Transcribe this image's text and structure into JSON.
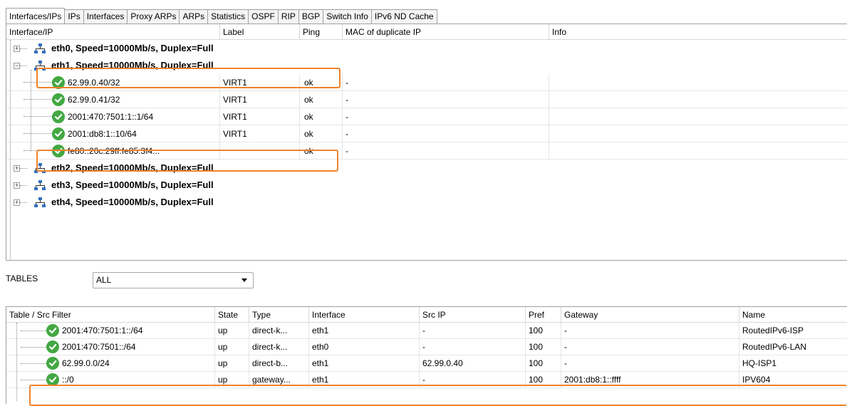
{
  "tabs": [
    {
      "label": "Interfaces/IPs",
      "active": true
    },
    {
      "label": "IPs",
      "active": false
    },
    {
      "label": "Interfaces",
      "active": false
    },
    {
      "label": "Proxy ARPs",
      "active": false
    },
    {
      "label": "ARPs",
      "active": false
    },
    {
      "label": "Statistics",
      "active": false
    },
    {
      "label": "OSPF",
      "active": false
    },
    {
      "label": "RIP",
      "active": false
    },
    {
      "label": "BGP",
      "active": false
    },
    {
      "label": "Switch Info",
      "active": false
    },
    {
      "label": "IPv6 ND Cache",
      "active": false
    }
  ],
  "tree": {
    "columns": [
      "Interface/IP",
      "Label",
      "Ping",
      "MAC of duplicate IP",
      "Info"
    ],
    "interfaces": [
      {
        "label": "eth0, Speed=10000Mb/s, Duplex=Full",
        "expanded": false,
        "ips": []
      },
      {
        "label": "eth1, Speed=10000Mb/s, Duplex=Full",
        "expanded": true,
        "ips": [
          {
            "ip": "62.99.0.40/32",
            "label": "VIRT1",
            "ping": "ok",
            "mac": "-",
            "info": ""
          },
          {
            "ip": "62.99.0.41/32",
            "label": "VIRT1",
            "ping": "ok",
            "mac": "-",
            "info": ""
          },
          {
            "ip": "2001:470:7501:1::1/64",
            "label": "VIRT1",
            "ping": "ok",
            "mac": "-",
            "info": ""
          },
          {
            "ip": "2001:db8:1::10/64",
            "label": "VIRT1",
            "ping": "ok",
            "mac": "-",
            "info": ""
          },
          {
            "ip": "fe80::20c:29ff:fe85:3f4...",
            "label": "",
            "ping": "ok",
            "mac": "-",
            "info": ""
          }
        ]
      },
      {
        "label": "eth2, Speed=10000Mb/s, Duplex=Full",
        "expanded": false,
        "ips": []
      },
      {
        "label": "eth3, Speed=10000Mb/s, Duplex=Full",
        "expanded": false,
        "ips": []
      },
      {
        "label": "eth4, Speed=10000Mb/s, Duplex=Full",
        "expanded": false,
        "ips": []
      }
    ]
  },
  "tables_selector": {
    "label": "TABLES",
    "value": "ALL"
  },
  "routes": {
    "columns": [
      "Table / Src Filter",
      "State",
      "Type",
      "Interface",
      "Src IP",
      "Pref",
      "Gateway",
      "Name"
    ],
    "rows": [
      {
        "table": "2001:470:7501:1::/64",
        "state": "up",
        "type": "direct-k...",
        "interface": "eth1",
        "src_ip": "-",
        "pref": "100",
        "gateway": "-",
        "name": "RoutedIPv6-ISP"
      },
      {
        "table": "2001:470:7501::/64",
        "state": "up",
        "type": "direct-k...",
        "interface": "eth0",
        "src_ip": "-",
        "pref": "100",
        "gateway": "-",
        "name": "RoutedIPv6-LAN"
      },
      {
        "table": "62.99.0.0/24",
        "state": "up",
        "type": "direct-b...",
        "interface": "eth1",
        "src_ip": "62.99.0.40",
        "pref": "100",
        "gateway": "-",
        "name": "HQ-ISP1"
      },
      {
        "table": "::/0",
        "state": "up",
        "type": "gateway...",
        "interface": "eth1",
        "src_ip": "-",
        "pref": "100",
        "gateway": "2001:db8:1::ffff",
        "name": "IPV604"
      }
    ]
  },
  "colors": {
    "highlight": "#f0822a",
    "ok_check": "#43a843",
    "net_icon": "#2e6fbf"
  }
}
